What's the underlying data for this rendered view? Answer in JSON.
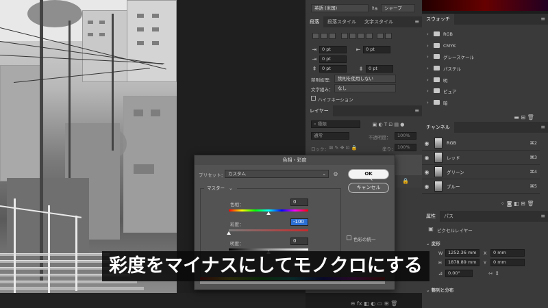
{
  "character_panel": {
    "language": "英語 (米国)",
    "antialias": "シャープ"
  },
  "swatches_panel": {
    "title": "スウォッチ",
    "groups": [
      "RGB",
      "CMYK",
      "グレースケール",
      "パステル",
      "明",
      "ピュア",
      "暗"
    ]
  },
  "paragraph_panel": {
    "tabs": [
      "段落",
      "段落スタイル",
      "文字スタイル"
    ],
    "indent_left": "0 pt",
    "indent_right": "0 pt",
    "indent_first": "0 pt",
    "space_before": "0 pt",
    "space_after": "0 pt",
    "kinsoku_label": "禁則処理：",
    "kinsoku_value": "禁則を使用しない",
    "mojikumi_label": "文字組み：",
    "mojikumi_value": "なし",
    "hyphenation": "ハイフネーション"
  },
  "layers_panel": {
    "title": "レイヤー",
    "search_kind": "種類",
    "blend_mode": "通常",
    "opacity_label": "不透明度：",
    "opacity_value": "100%",
    "lock_label": "ロック：",
    "fill_label": "塗り：",
    "fill_value": "100%"
  },
  "channels_panel": {
    "title": "チャンネル",
    "channels": [
      {
        "name": "RGB",
        "shortcut": "⌘2"
      },
      {
        "name": "レッド",
        "shortcut": "⌘3"
      },
      {
        "name": "グリーン",
        "shortcut": "⌘4"
      },
      {
        "name": "ブルー",
        "shortcut": "⌘5"
      }
    ]
  },
  "properties_panel": {
    "tabs": [
      "属性",
      "パス"
    ],
    "layer_type": "ピクセルレイヤー",
    "transform_section": "変形",
    "w_label": "W",
    "w_value": "1252.36 mm",
    "h_label": "H",
    "h_value": "1878.89 mm",
    "x_label": "X",
    "x_value": "0 mm",
    "y_label": "Y",
    "y_value": "0 mm",
    "angle": "0.00°",
    "align_section": "整列と分布"
  },
  "dialog": {
    "title": "色相・彩度",
    "preset_label": "プリセット：",
    "preset_value": "カスタム",
    "ok_label": "OK",
    "cancel_label": "キャンセル",
    "channel_value": "マスター",
    "hue_label": "色相：",
    "hue_value": "0",
    "saturation_label": "彩度：",
    "saturation_value": "-100",
    "lightness_label": "明度：",
    "lightness_value": "0",
    "colorize_label": "色彩の統一"
  },
  "caption": "彩度をマイナスにしてモノクロにする"
}
